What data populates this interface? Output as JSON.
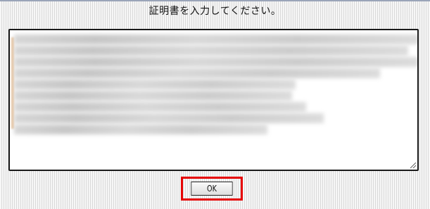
{
  "dialog": {
    "prompt": "証明書を入力してください。"
  },
  "certificate_input": {
    "value": "",
    "content_obscured": true
  },
  "actions": {
    "ok_label": "OK"
  },
  "colors": {
    "highlight": "#e60000",
    "background_stripe": "#d9d9d9"
  }
}
